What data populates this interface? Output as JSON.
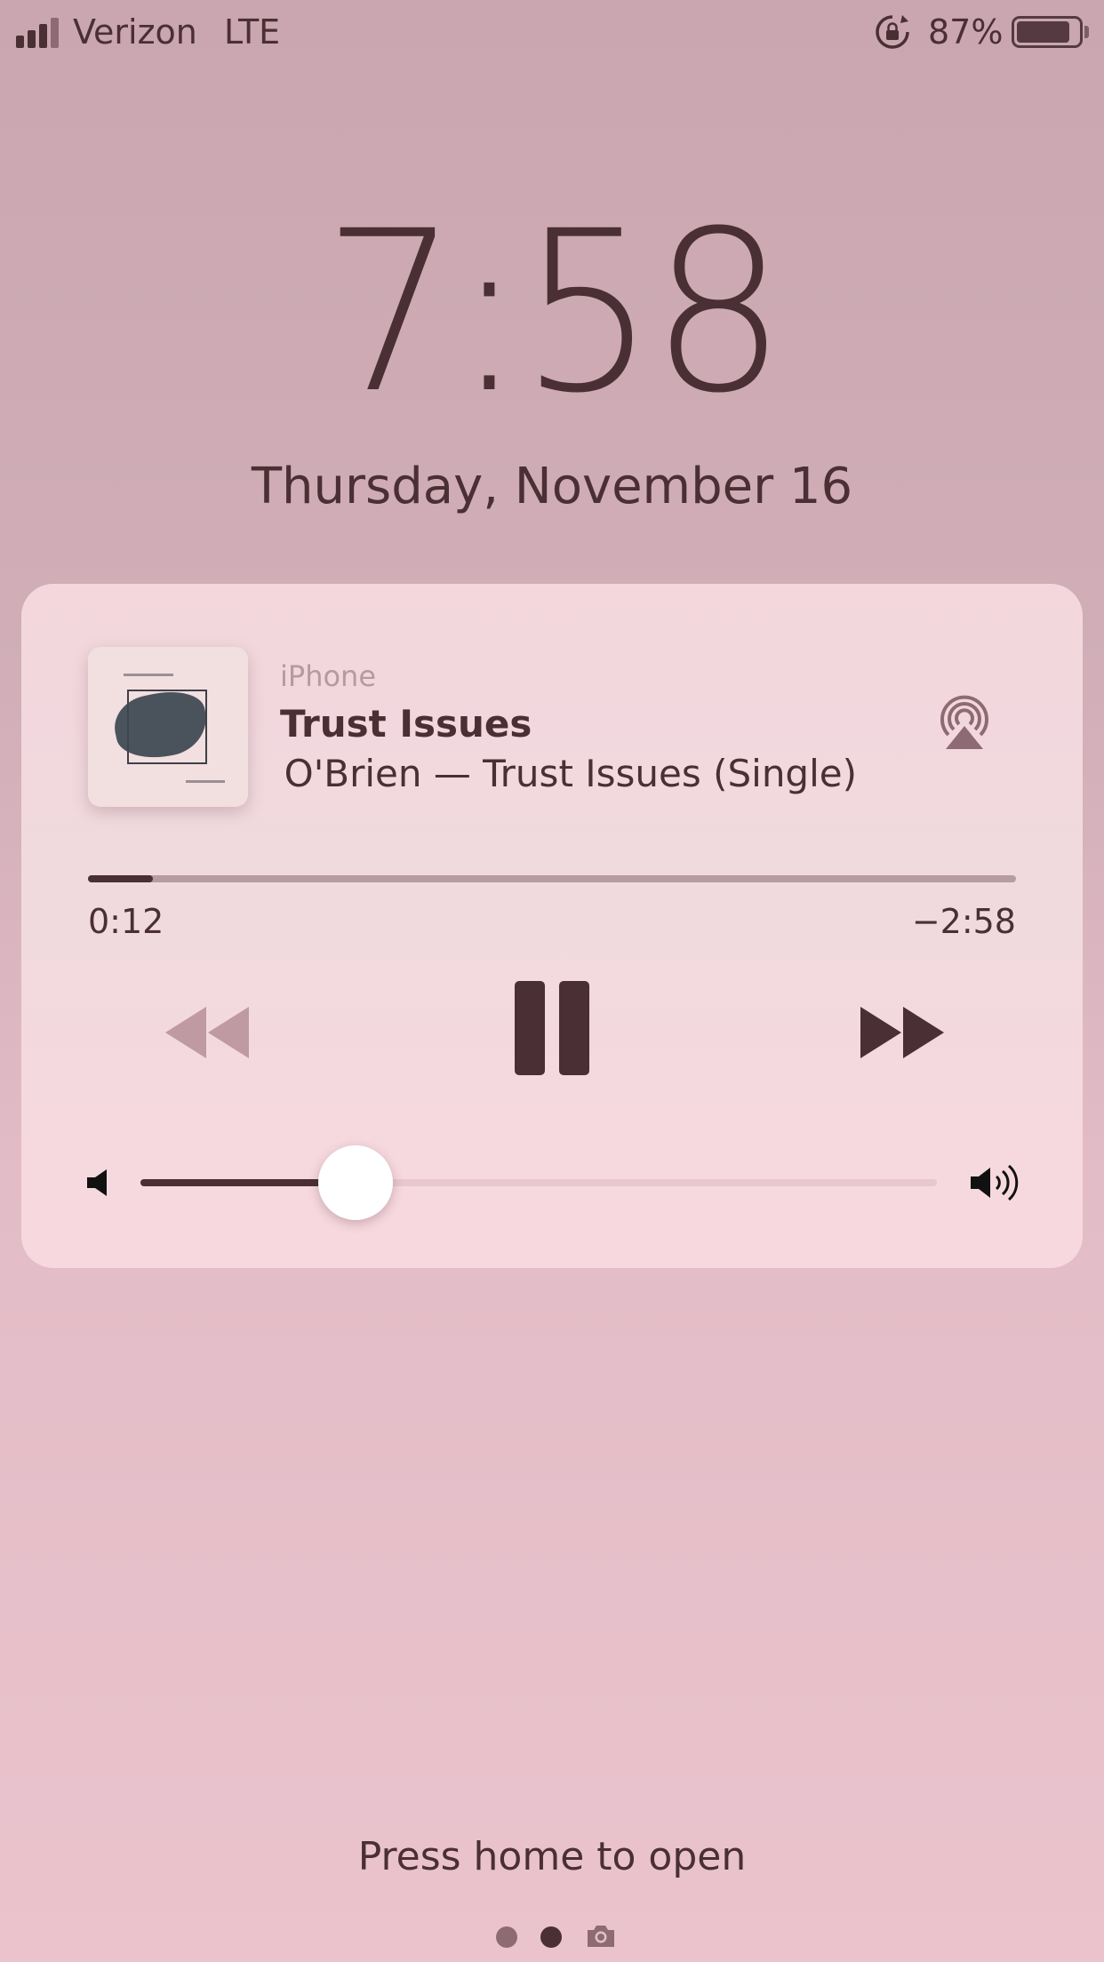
{
  "status_bar": {
    "carrier": "Verizon",
    "network": "LTE",
    "battery_percent": "87%",
    "battery_level": 0.87,
    "signal_bars_filled": 3,
    "signal_bars_total": 4,
    "icons": [
      "signal-bars-icon",
      "rotation-lock-icon",
      "battery-icon"
    ]
  },
  "lock_screen": {
    "time": "7:58",
    "date": "Thursday, November 16",
    "hint": "Press home to open",
    "pages": {
      "active_index": 1,
      "count": 2,
      "extra_icon": "camera-icon"
    }
  },
  "now_playing": {
    "source": "iPhone",
    "title": "Trust Issues",
    "subtitle": "O'Brien — Trust Issues (Single)",
    "artwork_icon": "album-artwork",
    "airplay_icon": "airplay-icon",
    "progress": {
      "elapsed": "0:12",
      "remaining": "−2:58",
      "fraction": 0.07
    },
    "controls": {
      "rewind_icon": "rewind-icon",
      "pause_icon": "pause-icon",
      "forward_icon": "fast-forward-icon"
    },
    "volume": {
      "level": 0.27,
      "low_icon": "volume-low-icon",
      "high_icon": "volume-high-icon"
    }
  },
  "colors": {
    "ink": "#4a2f35",
    "background_top": "#c9a6b0",
    "background_bottom": "#eac3cd",
    "card": "#f3d7dd",
    "knob": "#ffffff"
  }
}
